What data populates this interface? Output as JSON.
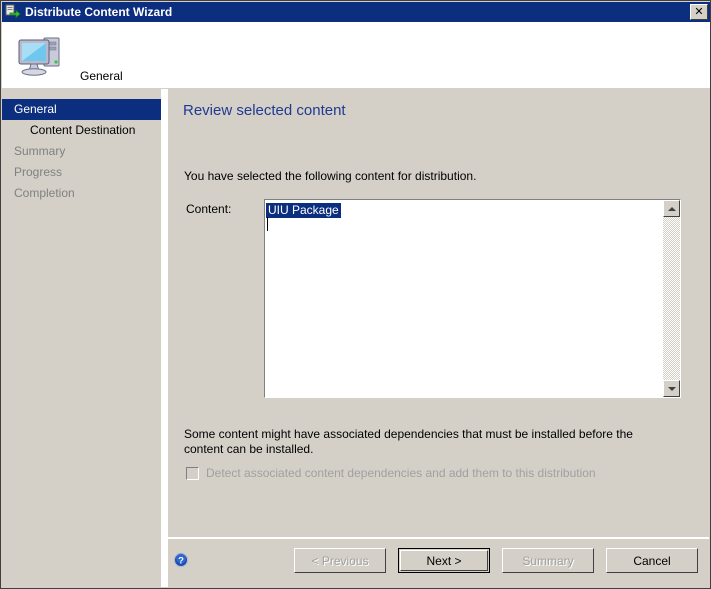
{
  "window": {
    "title": "Distribute Content Wizard",
    "title_icon": "distribute-content-icon",
    "close_label": "✕"
  },
  "header": {
    "icon": "computer-icon",
    "title": "General"
  },
  "sidebar": {
    "items": [
      {
        "label": "General",
        "state": "selected"
      },
      {
        "label": "Content Destination",
        "state": "indent"
      },
      {
        "label": "Summary",
        "state": "disabled"
      },
      {
        "label": "Progress",
        "state": "disabled"
      },
      {
        "label": "Completion",
        "state": "disabled"
      }
    ]
  },
  "main": {
    "heading": "Review selected content",
    "intro_text": "You have selected the following content for distribution.",
    "content_label": "Content:",
    "content_list": [
      {
        "label": "UIU Package",
        "selected": true
      }
    ],
    "dependency_note": "Some content might have associated dependencies that must be installed before the content can be installed.",
    "dependency_checkbox_label": "Detect associated content dependencies and add them to this distribution",
    "dependency_checkbox_checked": false,
    "dependency_checkbox_enabled": false
  },
  "footer": {
    "help_icon": "help-question-icon",
    "buttons": [
      {
        "label": "< Previous",
        "enabled": false,
        "default": false
      },
      {
        "label": "Next >",
        "enabled": true,
        "default": true
      },
      {
        "label": "Summary",
        "enabled": false,
        "default": false
      },
      {
        "label": "Cancel",
        "enabled": true,
        "default": false
      }
    ]
  },
  "colors": {
    "title_bar": "#0c2e7e",
    "selection": "#0c2e7e",
    "heading": "#1f3a93",
    "face": "#d4d0c8",
    "disabled_text": "#a0a0a0"
  }
}
